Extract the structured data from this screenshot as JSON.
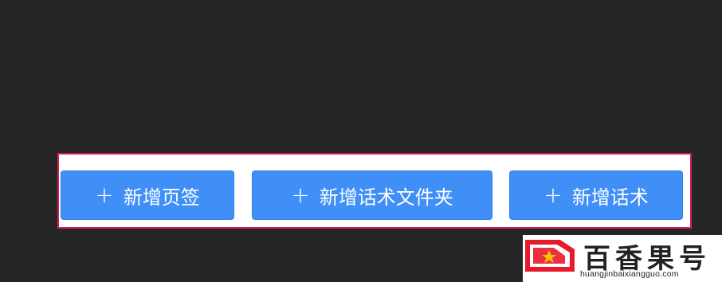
{
  "toolbar": {
    "buttons": [
      {
        "icon": "plus-icon",
        "plus": "+",
        "label": "新增页签"
      },
      {
        "icon": "plus-icon",
        "plus": "+",
        "label": "新增话术文件夹"
      },
      {
        "icon": "plus-icon",
        "plus": "+",
        "label": "新增话术"
      }
    ]
  },
  "watermark": {
    "title": "百香果号",
    "url": "huangjinbaixiangguo.com"
  },
  "colors": {
    "button": "#3f8ff7",
    "frame": "#d6204f",
    "background": "#252525"
  }
}
